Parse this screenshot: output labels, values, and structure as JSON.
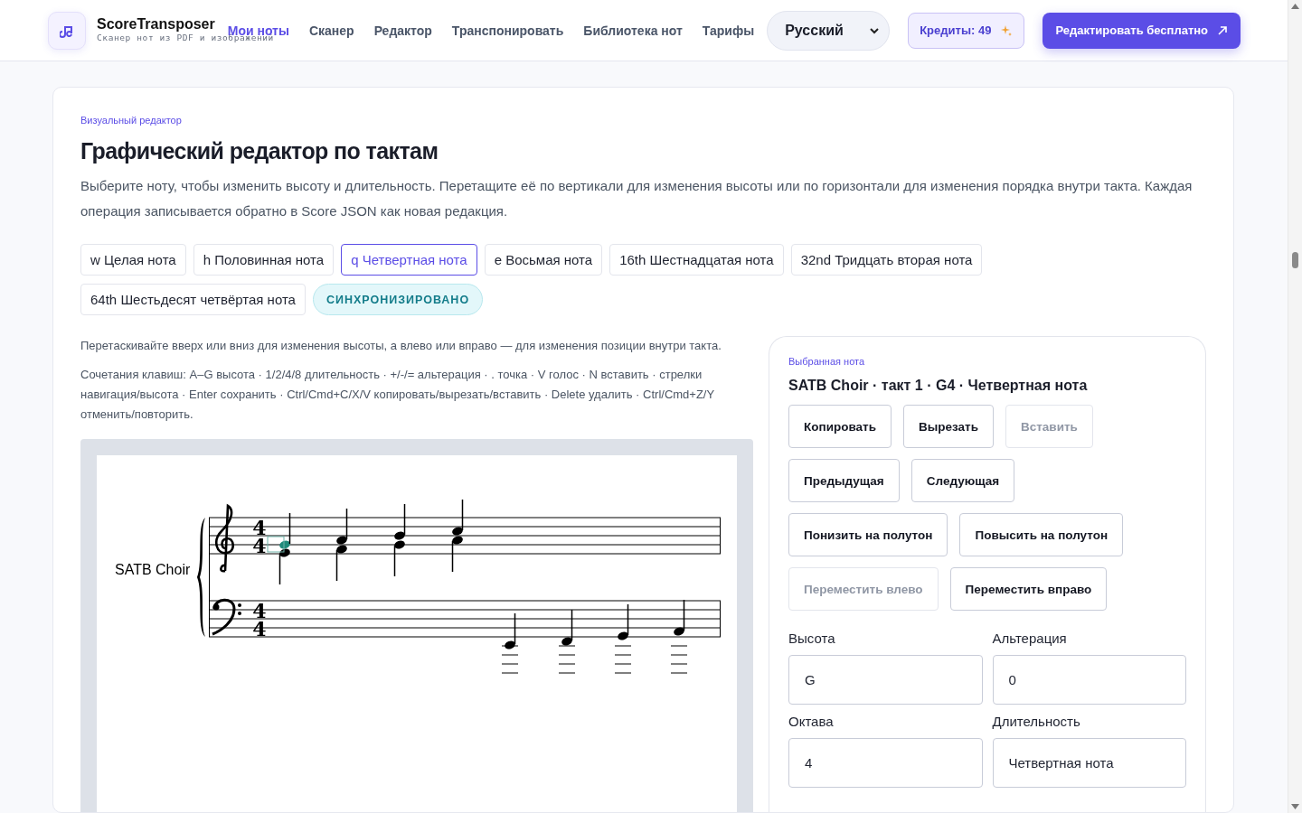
{
  "header": {
    "brand": "ScoreTransposer",
    "tagline": "Сканер нот из PDF и изображений",
    "nav": [
      {
        "label": "Мои ноты",
        "selected": true
      },
      {
        "label": "Сканер",
        "selected": false
      },
      {
        "label": "Редактор",
        "selected": false
      },
      {
        "label": "Транспонировать",
        "selected": false
      },
      {
        "label": "Библиотека нот",
        "selected": false
      },
      {
        "label": "Тарифы",
        "selected": false
      }
    ],
    "language": "Русский",
    "credits": "Кредиты: 49",
    "cta": "Редактировать бесплатно"
  },
  "editor": {
    "eyebrow": "Визуальный редактор",
    "title": "Графический редактор по тактам",
    "description": "Выберите ноту, чтобы изменить высоту и длительность. Перетащите её по вертикали для изменения высоты или по горизонтали для изменения порядка внутри такта. Каждая операция записывается обратно в Score JSON как новая редакция.",
    "durations": [
      {
        "symbol": "w",
        "label": "Целая нота",
        "selected": false
      },
      {
        "symbol": "h",
        "label": "Половинная нота",
        "selected": false
      },
      {
        "symbol": "q",
        "label": "Четвертная нота",
        "selected": true
      },
      {
        "symbol": "e",
        "label": "Восьмая нота",
        "selected": false
      },
      {
        "symbol": "16th",
        "label": "Шестнадцатая нота",
        "selected": false
      },
      {
        "symbol": "32nd",
        "label": "Тридцать вторая нота",
        "selected": false
      },
      {
        "symbol": "64th",
        "label": "Шестьдесят четвёртая нота",
        "selected": false
      }
    ],
    "status": "СИНХРОНИЗИРОВАНО",
    "hint": "Перетаскивайте вверх или вниз для изменения высоты, а влево или вправо — для изменения позиции внутри такта.",
    "shortcuts": "Сочетания клавиш: A–G высота · 1/2/4/8 длительность · +/-/= альтерация · . точка · V голос · N вставить · стрелки навигация/высота · Enter сохранить · Ctrl/Cmd+C/X/V копировать/вырезать/вставить · Delete удалить · Ctrl/Cmd+Z/Y отменить/повторить.",
    "score": {
      "part": "SATB Choir",
      "time_signatures": [
        {
          "upper": "4",
          "lower": "4"
        },
        {
          "upper": "4",
          "lower": "4"
        }
      ]
    }
  },
  "selected_note": {
    "eyebrow": "Выбранная нота",
    "title": "SATB Choir · такт 1 · G4 · Четвертная нота",
    "buttons": [
      {
        "label": "Копировать",
        "disabled": false
      },
      {
        "label": "Вырезать",
        "disabled": false
      },
      {
        "label": "Вставить",
        "disabled": true
      },
      {
        "label": "Предыдущая",
        "disabled": false
      },
      {
        "label": "Следующая",
        "disabled": false
      },
      {
        "label": "Понизить на полутон",
        "disabled": false
      },
      {
        "label": "Повысить на полутон",
        "disabled": false
      },
      {
        "label": "Переместить влево",
        "disabled": true
      },
      {
        "label": "Переместить вправо",
        "disabled": false
      }
    ],
    "fields": [
      {
        "label": "Высота",
        "value": "G"
      },
      {
        "label": "Альтерация",
        "value": "0"
      },
      {
        "label": "Октава",
        "value": "4"
      },
      {
        "label": "Длительность",
        "value": "Четвертная нота"
      }
    ]
  }
}
